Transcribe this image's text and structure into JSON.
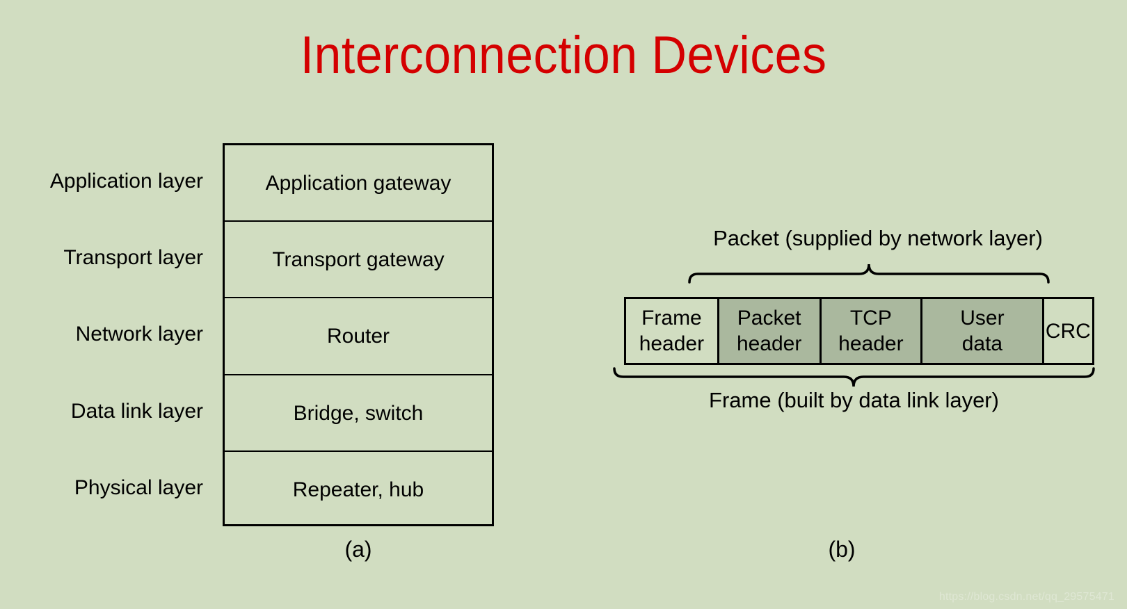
{
  "slide": {
    "title": "Interconnection Devices",
    "background_color": "#d1ddc1",
    "title_color": "#d40000",
    "shaded_cell_color": "#aab89e"
  },
  "part_a": {
    "caption": "(a)",
    "rows": [
      {
        "layer": "Application layer",
        "device": "Application gateway"
      },
      {
        "layer": "Transport layer",
        "device": "Transport gateway"
      },
      {
        "layer": "Network layer",
        "device": "Router"
      },
      {
        "layer": "Data link layer",
        "device": "Bridge, switch"
      },
      {
        "layer": "Physical layer",
        "device": "Repeater, hub"
      }
    ]
  },
  "part_b": {
    "caption": "(b)",
    "top_brace_label": "Packet (supplied by network layer)",
    "bottom_brace_label": "Frame (built by data link layer)",
    "fields": [
      {
        "line1": "Frame",
        "line2": "header",
        "shaded": false
      },
      {
        "line1": "Packet",
        "line2": "header",
        "shaded": true
      },
      {
        "line1": "TCP",
        "line2": "header",
        "shaded": true
      },
      {
        "line1": "User",
        "line2": "data",
        "shaded": true
      },
      {
        "line1": "CRC",
        "line2": "",
        "shaded": false
      }
    ]
  },
  "watermark": {
    "text": "https://blog.csdn.net/qq_29575471"
  }
}
